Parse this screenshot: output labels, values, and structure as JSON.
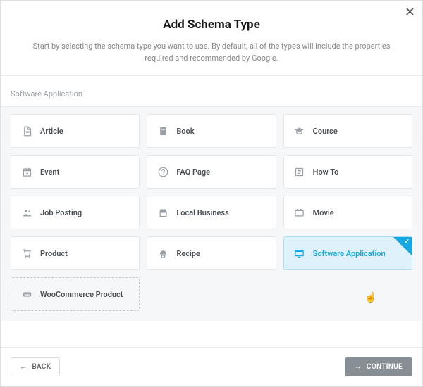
{
  "modal": {
    "title": "Add Schema Type",
    "subtitle": "Start by selecting the schema type you want to use. By default, all of the types will include the properties required and recommended by Google."
  },
  "search": {
    "value": "Software Application"
  },
  "types": [
    {
      "icon": "article",
      "label": "Article"
    },
    {
      "icon": "book",
      "label": "Book"
    },
    {
      "icon": "course",
      "label": "Course"
    },
    {
      "icon": "event",
      "label": "Event"
    },
    {
      "icon": "faq",
      "label": "FAQ Page"
    },
    {
      "icon": "howto",
      "label": "How To"
    },
    {
      "icon": "job",
      "label": "Job Posting"
    },
    {
      "icon": "local",
      "label": "Local Business"
    },
    {
      "icon": "movie",
      "label": "Movie"
    },
    {
      "icon": "product",
      "label": "Product"
    },
    {
      "icon": "recipe",
      "label": "Recipe"
    },
    {
      "icon": "software",
      "label": "Software Application",
      "selected": true
    },
    {
      "icon": "woo",
      "label": "WooCommerce Product",
      "dashed": true
    }
  ],
  "footer": {
    "back": "BACK",
    "continue": "CONTINUE"
  }
}
